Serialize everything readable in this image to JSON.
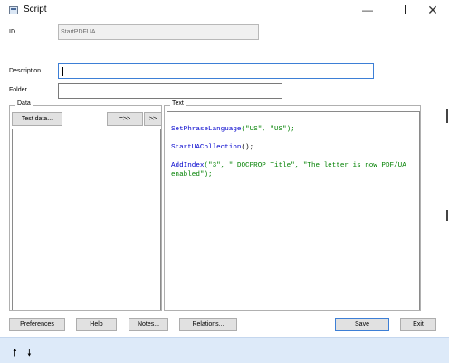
{
  "window": {
    "title": "Script",
    "controls": {
      "minimize": "—",
      "close": "✕"
    }
  },
  "form": {
    "id_label": "ID",
    "id_value": "StartPDFUA",
    "description_label": "Description",
    "description_value": "",
    "folder_label": "Folder",
    "folder_value": ""
  },
  "data_panel": {
    "title": "Data",
    "test_data_button": "Test data...",
    "move_button": "=>>",
    "move_all_button": ">>"
  },
  "text_panel": {
    "title": "Text",
    "lines": [
      {
        "fn": "SetPhraseLanguage",
        "args": "(\"US\", \"US\");"
      },
      {
        "fn": "StartUACollection",
        "args": "();"
      },
      {
        "fn": "AddIndex",
        "args": "(\"3\", \"_DOCPROP_Title\", \"The letter is now PDF/UA enabled\");"
      }
    ]
  },
  "buttons": {
    "preferences": "Preferences",
    "help": "Help",
    "notes": "Notes...",
    "relations": "Relations...",
    "save": "Save",
    "exit": "Exit"
  },
  "bottom_bar": {
    "up_arrow": "🠕",
    "down_arrow": "🠗"
  },
  "colors": {
    "function": "#0000cc",
    "string": "#008000",
    "focus_border": "#3d7fd6",
    "bottom_bar": "#ddeaf9"
  }
}
